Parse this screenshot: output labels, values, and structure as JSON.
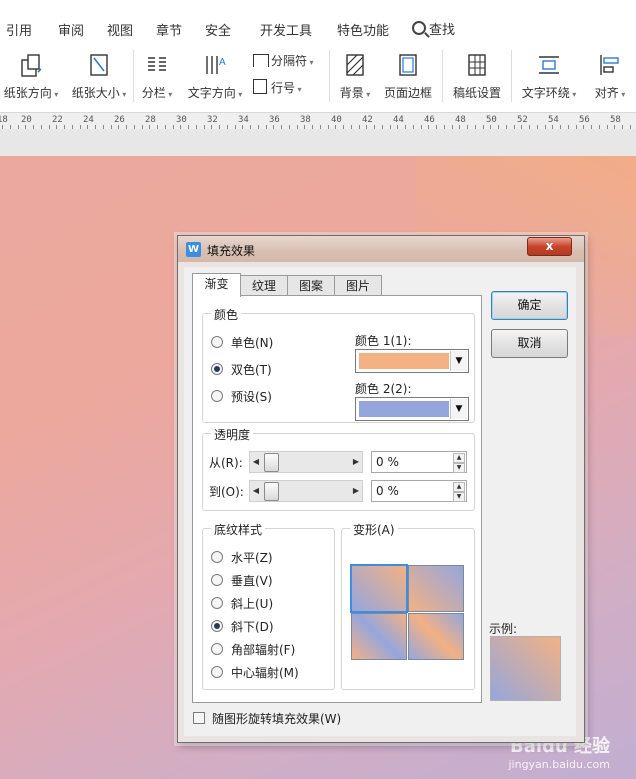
{
  "menu": {
    "items": [
      "引用",
      "审阅",
      "视图",
      "章节",
      "安全",
      "开发工具",
      "特色功能"
    ],
    "search_label": "查找"
  },
  "toolbar": {
    "paper_orientation": "纸张方向",
    "paper_size": "纸张大小",
    "columns": "分栏",
    "text_direction": "文字方向",
    "separator": "分隔符",
    "line_number": "行号",
    "background": "背景",
    "page_border": "页面边框",
    "manuscript_settings": "稿纸设置",
    "text_wrap": "文字环绕",
    "align": "对齐"
  },
  "ruler": {
    "ticks": [
      "18",
      "20",
      "22",
      "24",
      "26",
      "28",
      "30",
      "32",
      "34",
      "36",
      "38",
      "40",
      "42",
      "44",
      "46",
      "48",
      "50",
      "52",
      "54",
      "56",
      "58"
    ]
  },
  "dialog": {
    "title": "填充效果",
    "close_glyph": "x",
    "tabs": [
      "渐变",
      "纹理",
      "图案",
      "图片"
    ],
    "colors_group": {
      "label": "颜色",
      "options": [
        "单色(N)",
        "双色(T)",
        "预设(S)"
      ],
      "selected": "双色(T)",
      "color1_label": "颜色 1(1):",
      "color1_value": "#f3b184",
      "color2_label": "颜色 2(2):",
      "color2_value": "#95a6dc"
    },
    "transparency_group": {
      "label": "透明度",
      "from_label": "从(R):",
      "from_value": "0 %",
      "to_label": "到(O):",
      "to_value": "0 %"
    },
    "shading_group": {
      "label": "底纹样式",
      "options": [
        "水平(Z)",
        "垂直(V)",
        "斜上(U)",
        "斜下(D)",
        "角部辐射(F)",
        "中心辐射(M)"
      ],
      "selected": "斜下(D)"
    },
    "variants_group": {
      "label": "变形(A)"
    },
    "rotate_checkbox": "随图形旋转填充效果(W)",
    "ok_label": "确定",
    "cancel_label": "取消",
    "sample_label": "示例:"
  },
  "watermark": {
    "text": "Baidu 经验",
    "sub": "jingyan.baidu.com"
  }
}
